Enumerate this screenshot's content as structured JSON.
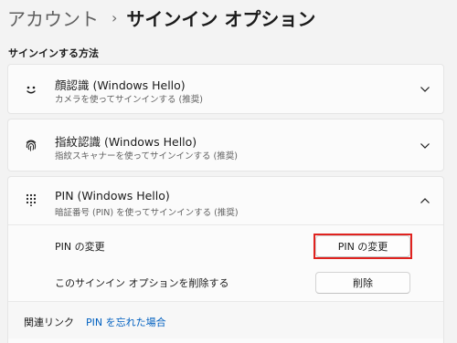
{
  "breadcrumb": {
    "parent": "アカウント",
    "separator": "›",
    "current": "サインイン オプション"
  },
  "section": {
    "label": "サインインする方法"
  },
  "options": {
    "face": {
      "title": "顔認識 (Windows Hello)",
      "subtitle": "カメラを使ってサインインする (推奨)",
      "icon": "smile-face-icon",
      "expanded": false
    },
    "fingerprint": {
      "title": "指紋認識 (Windows Hello)",
      "subtitle": "指紋スキャナーを使ってサインインする (推奨)",
      "icon": "fingerprint-icon",
      "expanded": false
    },
    "pin": {
      "title": "PIN (Windows Hello)",
      "subtitle": "暗証番号 (PIN) を使ってサインインする (推奨)",
      "icon": "keypad-icon",
      "expanded": true,
      "change_row": {
        "label": "PIN の変更",
        "button": "PIN の変更"
      },
      "remove_row": {
        "label": "このサインイン オプションを削除する",
        "button": "削除"
      }
    }
  },
  "related": {
    "label": "関連リンク",
    "link": "PIN を忘れた場合"
  },
  "colors": {
    "background": "#f3f3f3",
    "card": "#fbfbfb",
    "link": "#0060c0",
    "highlight": "#e0221f"
  }
}
